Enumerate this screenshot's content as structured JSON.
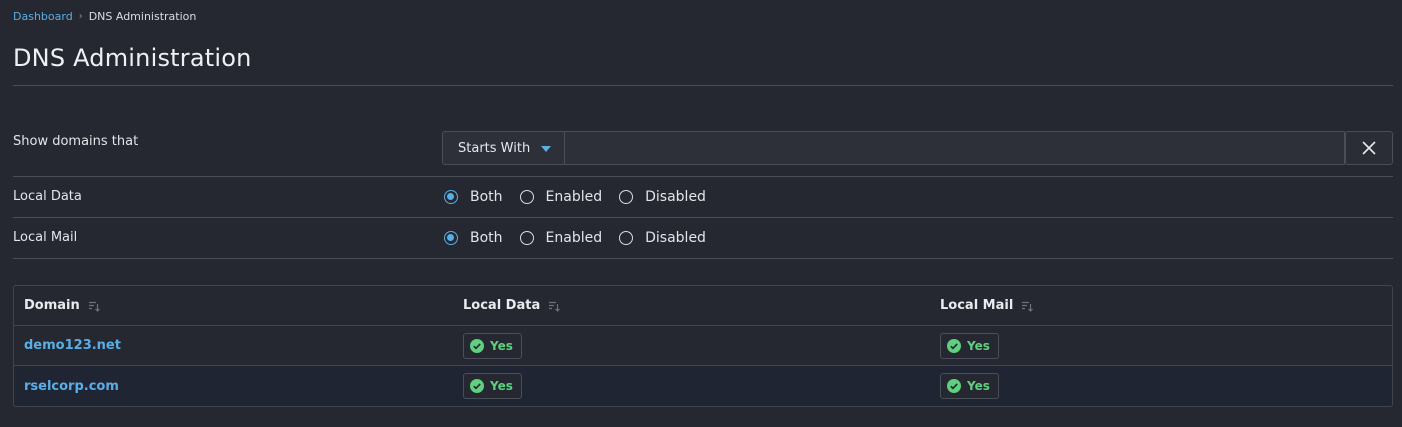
{
  "breadcrumb": {
    "home": "Dashboard",
    "current": "DNS Administration"
  },
  "page": {
    "title": "DNS Administration"
  },
  "filters": {
    "domain_filter": {
      "label": "Show domains that",
      "mode_selected": "Starts With",
      "search_value": "",
      "search_placeholder": ""
    },
    "local_data": {
      "label": "Local Data",
      "options": [
        "Both",
        "Enabled",
        "Disabled"
      ],
      "selected": "Both"
    },
    "local_mail": {
      "label": "Local Mail",
      "options": [
        "Both",
        "Enabled",
        "Disabled"
      ],
      "selected": "Both"
    }
  },
  "table": {
    "columns": [
      "Domain",
      "Local Data",
      "Local Mail"
    ],
    "rows": [
      {
        "domain": "demo123.net",
        "local_data": "Yes",
        "local_mail": "Yes"
      },
      {
        "domain": "rselcorp.com",
        "local_data": "Yes",
        "local_mail": "Yes"
      }
    ]
  },
  "colors": {
    "accent": "#5aaee6",
    "success": "#5fcf80",
    "background": "#252830"
  }
}
